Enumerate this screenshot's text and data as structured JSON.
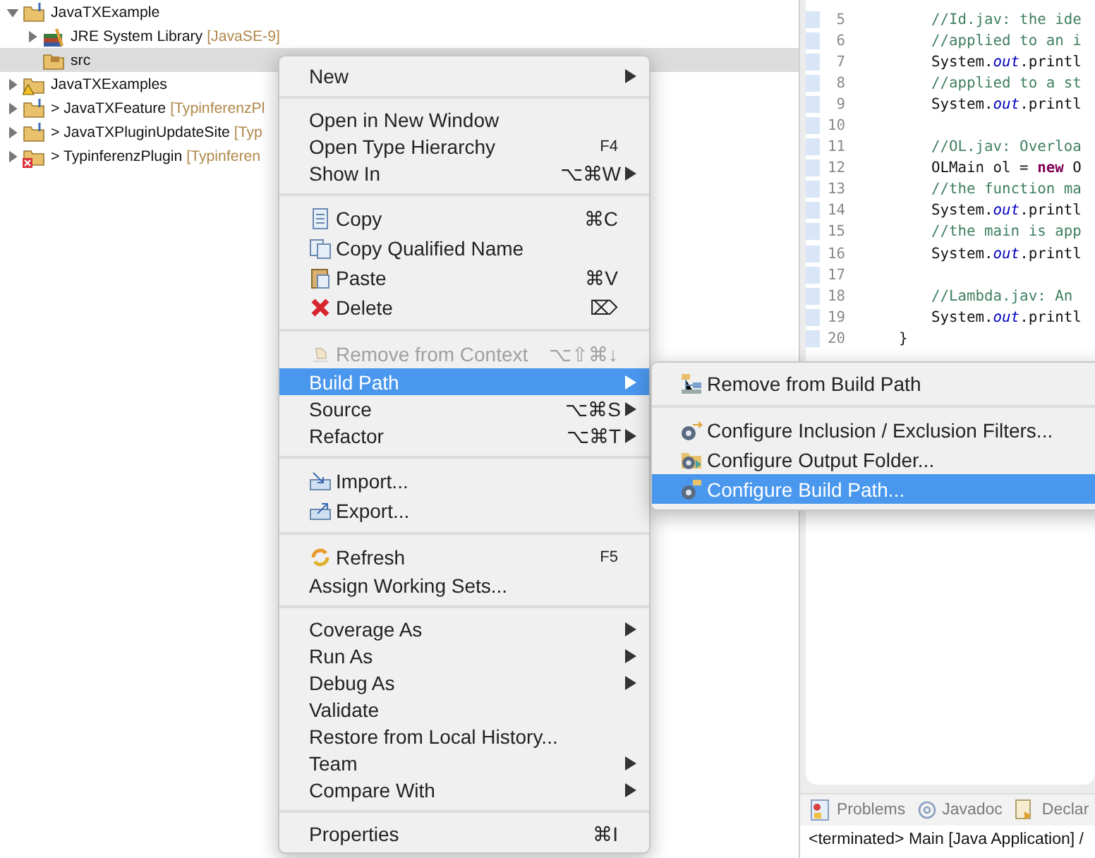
{
  "explorer": {
    "items": [
      {
        "label": "JavaTXExample",
        "expanded": true,
        "selected": false,
        "kind": "project",
        "children": [
          {
            "label": "JRE System Library",
            "decoration": "[JavaSE-9]",
            "expanded": false,
            "selected": false,
            "kind": "library"
          },
          {
            "label": "src",
            "selected": true,
            "kind": "package"
          }
        ]
      },
      {
        "label": "JavaTXExamples",
        "expanded": false,
        "selected": false,
        "kind": "warning-project"
      },
      {
        "label": "> JavaTXFeature",
        "decoration": "[TypinferenzPl",
        "expanded": false,
        "selected": false,
        "kind": "project"
      },
      {
        "label": "> JavaTXPluginUpdateSite",
        "decoration": "[Typ",
        "expanded": false,
        "selected": false,
        "kind": "project"
      },
      {
        "label": "> TypinferenzPlugin",
        "decoration": "[Typinferen",
        "expanded": false,
        "selected": false,
        "kind": "error-project"
      }
    ]
  },
  "editor": {
    "lines": [
      {
        "number": "5",
        "segments": [
          {
            "text": "//Id.jav: the ide",
            "kind": "comment"
          }
        ]
      },
      {
        "number": "6",
        "segments": [
          {
            "text": "//applied to an i",
            "kind": "comment"
          }
        ]
      },
      {
        "number": "7",
        "segments": [
          {
            "text": "System.",
            "kind": "plain"
          },
          {
            "text": "out",
            "kind": "field"
          },
          {
            "text": ".printl",
            "kind": "plain"
          }
        ]
      },
      {
        "number": "8",
        "segments": [
          {
            "text": "//applied to a st",
            "kind": "comment"
          }
        ]
      },
      {
        "number": "9",
        "segments": [
          {
            "text": "System.",
            "kind": "plain"
          },
          {
            "text": "out",
            "kind": "field"
          },
          {
            "text": ".printl",
            "kind": "plain"
          }
        ]
      },
      {
        "number": "10"
      },
      {
        "number": "11",
        "segments": [
          {
            "text": "//OL.jav: Overloa",
            "kind": "comment"
          }
        ]
      },
      {
        "number": "12",
        "segments": [
          {
            "text": "OLMain ol = ",
            "kind": "plain"
          },
          {
            "text": "new",
            "kind": "keyword"
          },
          {
            "text": " O",
            "kind": "plain"
          }
        ]
      },
      {
        "number": "13",
        "segments": [
          {
            "text": "//the function ma",
            "kind": "comment"
          }
        ]
      },
      {
        "number": "14",
        "segments": [
          {
            "text": "System.",
            "kind": "plain"
          },
          {
            "text": "out",
            "kind": "field"
          },
          {
            "text": ".printl",
            "kind": "plain"
          }
        ]
      },
      {
        "number": "15",
        "segments": [
          {
            "text": "//the main is app",
            "kind": "comment"
          }
        ]
      },
      {
        "number": "16",
        "segments": [
          {
            "text": "System.",
            "kind": "plain"
          },
          {
            "text": "out",
            "kind": "field"
          },
          {
            "text": ".printl",
            "kind": "plain"
          }
        ]
      },
      {
        "number": "17"
      },
      {
        "number": "18",
        "segments": [
          {
            "text": "//Lambda.jav: An",
            "kind": "comment"
          }
        ]
      },
      {
        "number": "19",
        "segments": [
          {
            "text": "System.",
            "kind": "plain"
          },
          {
            "text": "out",
            "kind": "field"
          },
          {
            "text": ".printl",
            "kind": "plain"
          }
        ]
      },
      {
        "number": "20",
        "outdent": true,
        "segments": [
          {
            "text": "}",
            "kind": "plain"
          }
        ]
      }
    ]
  },
  "bottom_panel": {
    "tabs": [
      {
        "label": "Problems",
        "selected": false
      },
      {
        "label": "Javadoc",
        "selected": false
      },
      {
        "label": "Declar",
        "selected": false
      }
    ],
    "console": "<terminated> Main [Java Application] /"
  },
  "context_menu": {
    "items": [
      {
        "kind": "item",
        "label": "New",
        "submenu": true
      },
      {
        "kind": "separator"
      },
      {
        "kind": "item",
        "label": "Open in New Window"
      },
      {
        "kind": "item",
        "label": "Open Type Hierarchy",
        "shortcut": "F4"
      },
      {
        "kind": "item",
        "label": "Show In",
        "shortcut": "⌥⌘W",
        "submenu": true
      },
      {
        "kind": "separator"
      },
      {
        "kind": "icon-item",
        "label": "Copy",
        "shortcut": "⌘C"
      },
      {
        "kind": "icon-item",
        "label": "Copy Qualified Name"
      },
      {
        "kind": "icon-item",
        "label": "Paste",
        "shortcut": "⌘V"
      },
      {
        "kind": "icon-item",
        "label": "Delete",
        "shortcut": "⌦"
      },
      {
        "kind": "separator"
      },
      {
        "kind": "icon-item",
        "label": "Remove from Context",
        "shortcut": "⌥⇧⌘↓",
        "disabled": true
      },
      {
        "kind": "item",
        "label": "Build Path",
        "submenu": true,
        "selected": true
      },
      {
        "kind": "item",
        "label": "Source",
        "shortcut": "⌥⌘S",
        "submenu": true
      },
      {
        "kind": "item",
        "label": "Refactor",
        "shortcut": "⌥⌘T",
        "submenu": true
      },
      {
        "kind": "separator"
      },
      {
        "kind": "icon-item",
        "label": "Import..."
      },
      {
        "kind": "icon-item",
        "label": "Export..."
      },
      {
        "kind": "separator"
      },
      {
        "kind": "icon-item",
        "label": "Refresh",
        "shortcut": "F5"
      },
      {
        "kind": "item",
        "label": "Assign Working Sets..."
      },
      {
        "kind": "separator"
      },
      {
        "kind": "item",
        "label": "Coverage As",
        "submenu": true
      },
      {
        "kind": "item",
        "label": "Run As",
        "submenu": true
      },
      {
        "kind": "item",
        "label": "Debug As",
        "submenu": true
      },
      {
        "kind": "item",
        "label": "Validate"
      },
      {
        "kind": "item",
        "label": "Restore from Local History..."
      },
      {
        "kind": "item",
        "label": "Team",
        "submenu": true
      },
      {
        "kind": "item",
        "label": "Compare With",
        "submenu": true
      },
      {
        "kind": "separator"
      },
      {
        "kind": "item",
        "label": "Properties",
        "shortcut": "⌘I"
      }
    ]
  },
  "build_path_submenu": {
    "items": [
      {
        "kind": "icon-item",
        "label": "Remove from Build Path",
        "selected": false
      },
      {
        "kind": "separator"
      },
      {
        "kind": "icon-item",
        "label": "Configure Inclusion / Exclusion Filters...",
        "selected": false
      },
      {
        "kind": "icon-item",
        "label": "Configure Output Folder...",
        "selected": false
      },
      {
        "kind": "icon-item",
        "label": "Configure Build Path...",
        "selected": true
      }
    ]
  }
}
